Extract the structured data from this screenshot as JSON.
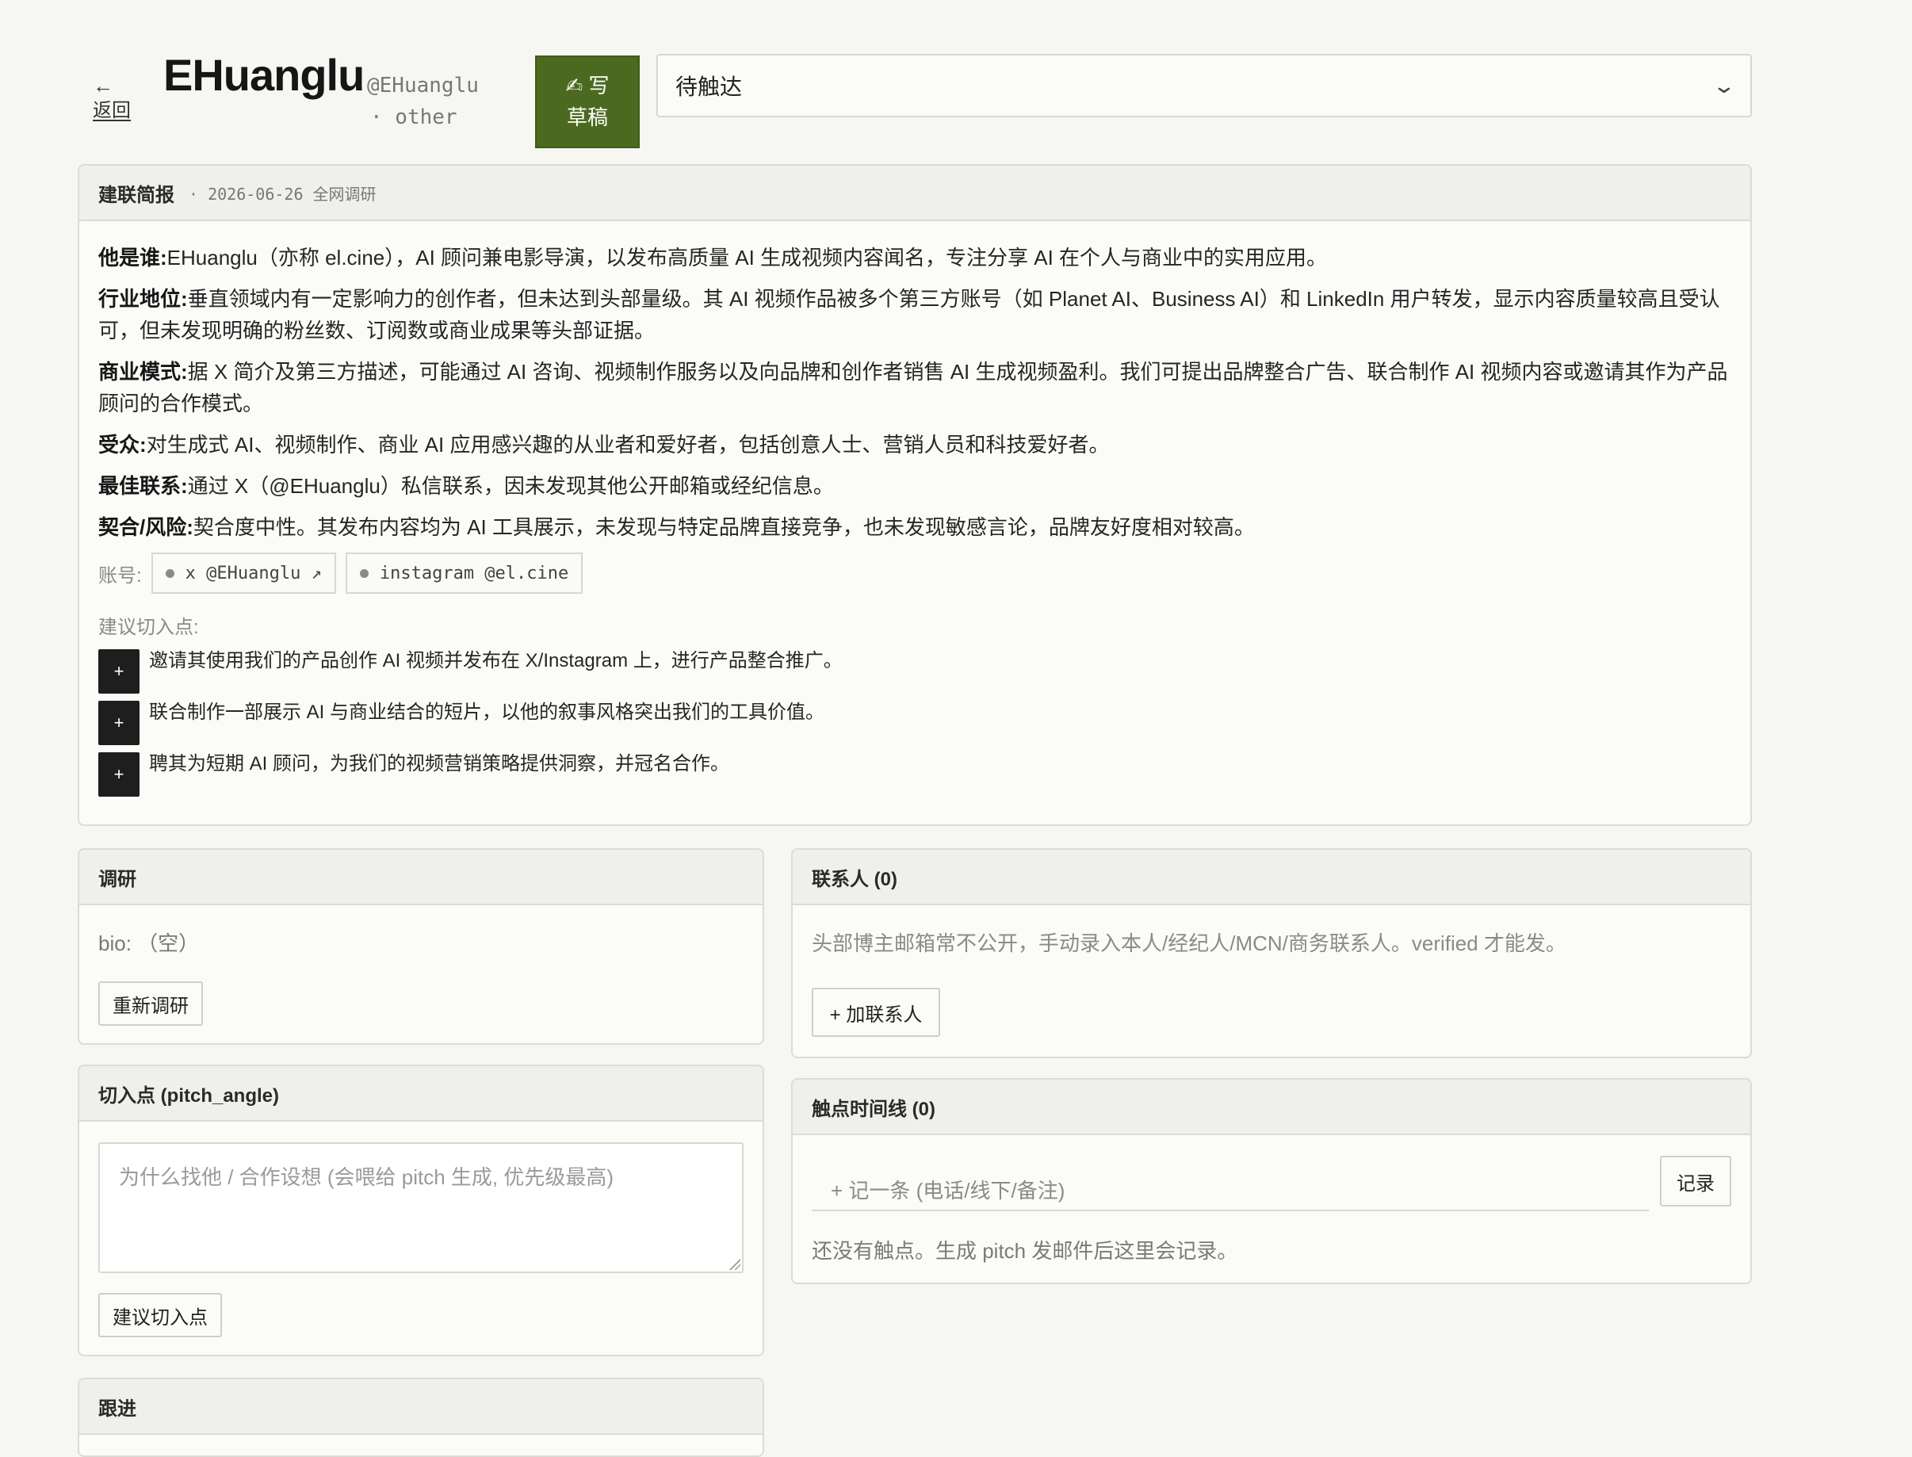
{
  "header": {
    "back_arrow": "←",
    "back_label": "返回",
    "title": "EHuanglu",
    "handle_line1": "@EHuanglu",
    "handle_line2": "· other",
    "write_line1": "✍ 写",
    "write_line2": "草稿",
    "status_value": "待触达",
    "status_chevron": "⌄"
  },
  "brief": {
    "title": "建联简报",
    "meta": "· 2026-06-26 全网调研",
    "rows": [
      {
        "label": "他是谁:",
        "text": "EHuanglu（亦称 el.cine），AI 顾问兼电影导演，以发布高质量 AI 生成视频内容闻名，专注分享 AI 在个人与商业中的实用应用。"
      },
      {
        "label": "行业地位:",
        "text": "垂直领域内有一定影响力的创作者，但未达到头部量级。其 AI 视频作品被多个第三方账号（如 Planet AI、Business AI）和 LinkedIn 用户转发，显示内容质量较高且受认可，但未发现明确的粉丝数、订阅数或商业成果等头部证据。"
      },
      {
        "label": "商业模式:",
        "text": "据 X 简介及第三方描述，可能通过 AI 咨询、视频制作服务以及向品牌和创作者销售 AI 生成视频盈利。我们可提出品牌整合广告、联合制作 AI 视频内容或邀请其作为产品顾问的合作模式。"
      },
      {
        "label": "受众:",
        "text": "对生成式 AI、视频制作、商业 AI 应用感兴趣的从业者和爱好者，包括创意人士、营销人员和科技爱好者。"
      },
      {
        "label": "最佳联系:",
        "text": "通过 X（@EHuanglu）私信联系，因未发现其他公开邮箱或经纪信息。"
      },
      {
        "label": "契合/风险:",
        "text": "契合度中性。其发布内容均为 AI 工具展示，未发现与特定品牌直接竞争，也未发现敏感言论，品牌友好度相对较高。"
      }
    ],
    "accounts_label": "账号:",
    "accounts": [
      {
        "text": "x @EHuanglu ↗"
      },
      {
        "text": "instagram @el.cine"
      }
    ],
    "pitch_label": "建议切入点:",
    "pitch_plus": "+",
    "pitches": [
      "邀请其使用我们的产品创作 AI 视频并发布在 X/Instagram 上，进行产品整合推广。",
      "联合制作一部展示 AI 与商业结合的短片，以他的叙事风格突出我们的工具价值。",
      "聘其为短期 AI 顾问，为我们的视频营销策略提供洞察，并冠名合作。"
    ]
  },
  "research": {
    "title": "调研",
    "bio": "bio: （空）",
    "button": "重新调研"
  },
  "contacts": {
    "title": "联系人 (0)",
    "note": "头部博主邮箱常不公开，手动录入本人/经纪人/MCN/商务联系人。verified 才能发。",
    "button": "+ 加联系人"
  },
  "angle": {
    "title": "切入点 (pitch_angle)",
    "placeholder": "为什么找他 / 合作设想 (会喂给 pitch 生成, 优先级最高)",
    "button": "建议切入点"
  },
  "timeline": {
    "title": "触点时间线 (0)",
    "input_placeholder": "+ 记一条 (电话/线下/备注)",
    "button": "记录",
    "empty": "还没有触点。生成 pitch 发邮件后这里会记录。"
  },
  "followup": {
    "title": "跟进"
  }
}
